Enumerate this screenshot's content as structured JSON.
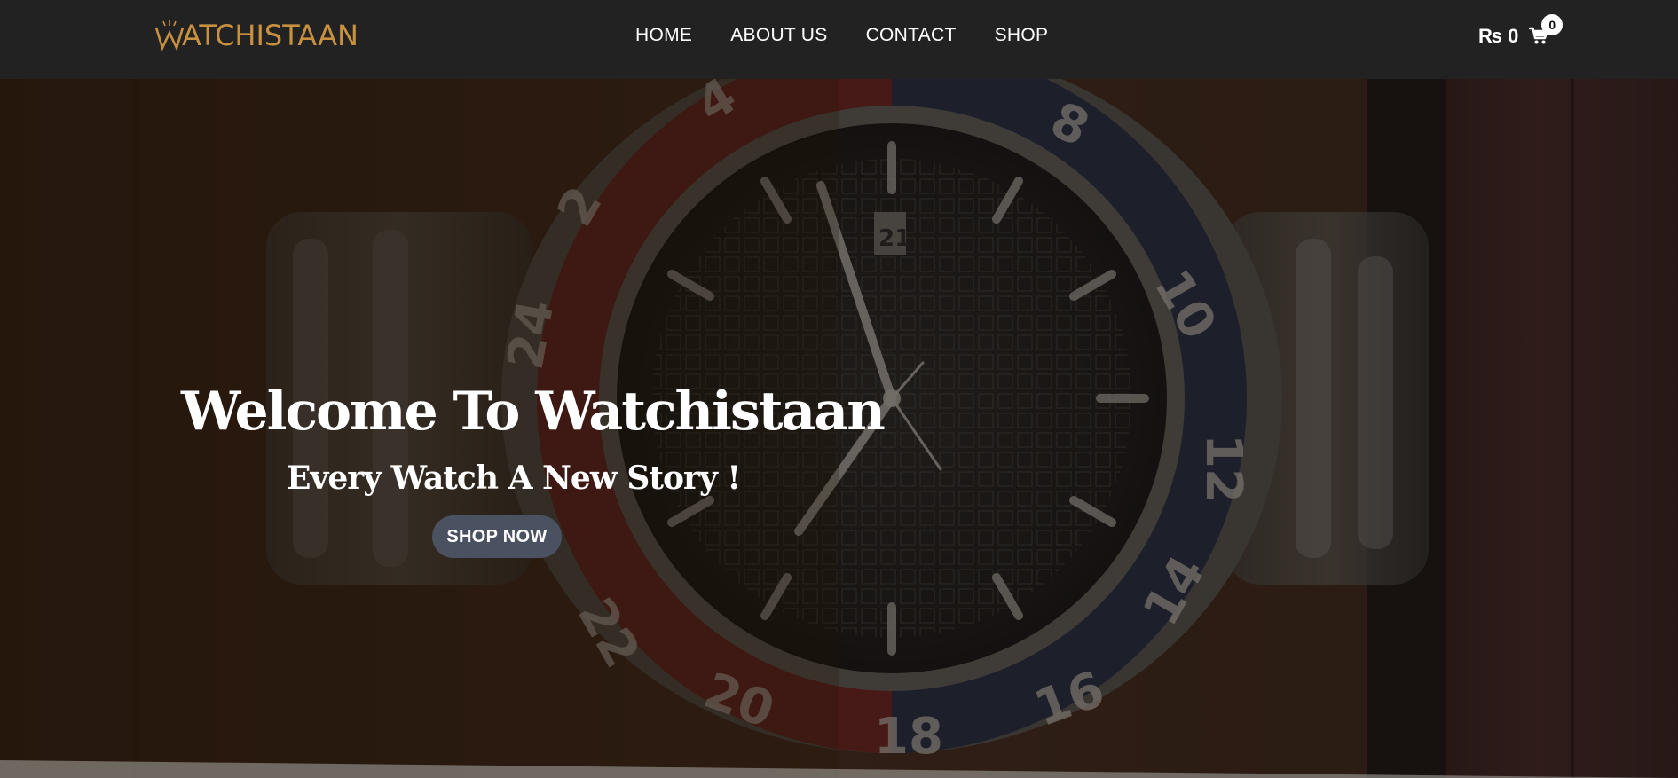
{
  "brand": {
    "logo_text": "ATCHISTAAN",
    "logo_alt": "WATCHISTAAN",
    "accent_color": "#c8913f"
  },
  "nav": {
    "items": [
      {
        "label": "HOME"
      },
      {
        "label": "ABOUT US"
      },
      {
        "label": "CONTACT"
      },
      {
        "label": "SHOP"
      }
    ]
  },
  "cart": {
    "total": "₨ 0",
    "count": "0",
    "icon": "cart-icon"
  },
  "hero": {
    "title": "Welcome To Watchistaan",
    "subtitle": "Every Watch A New Story !",
    "cta_label": "SHOP NOW",
    "background_image": "wristwatch with red and blue bezel on wooden surface",
    "cta_color": "#4a5161"
  }
}
